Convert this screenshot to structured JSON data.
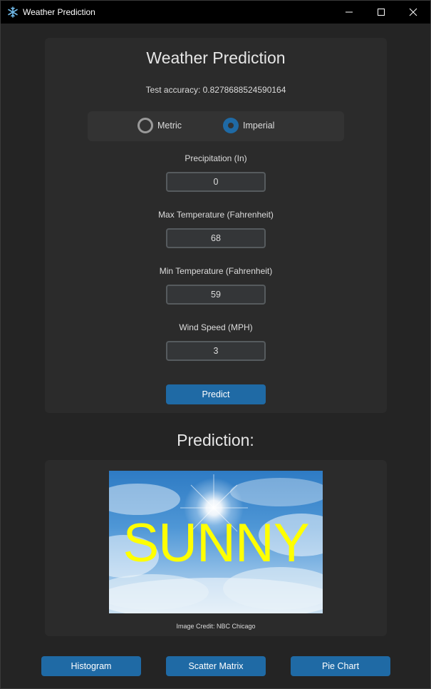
{
  "window": {
    "title": "Weather Prediction",
    "accent": "#1f6aa5"
  },
  "main": {
    "heading": "Weather Prediction",
    "accuracy": "Test accuracy: 0.8278688524590164",
    "units": {
      "options": [
        "Metric",
        "Imperial"
      ],
      "selected": "Imperial"
    },
    "fields": [
      {
        "label": "Precipitation (In)",
        "value": "0"
      },
      {
        "label": "Max Temperature (Fahrenheit)",
        "value": "68"
      },
      {
        "label": "Min Temperature (Fahrenheit)",
        "value": "59"
      },
      {
        "label": "Wind Speed (MPH)",
        "value": "3"
      }
    ],
    "predict_label": "Predict"
  },
  "prediction": {
    "heading": "Prediction:",
    "result_text": "SUNNY",
    "credit": "Image Credit: NBC Chicago"
  },
  "bottom_buttons": {
    "histogram": "Histogram",
    "scatter_matrix": "Scatter Matrix",
    "pie_chart": "Pie Chart"
  }
}
